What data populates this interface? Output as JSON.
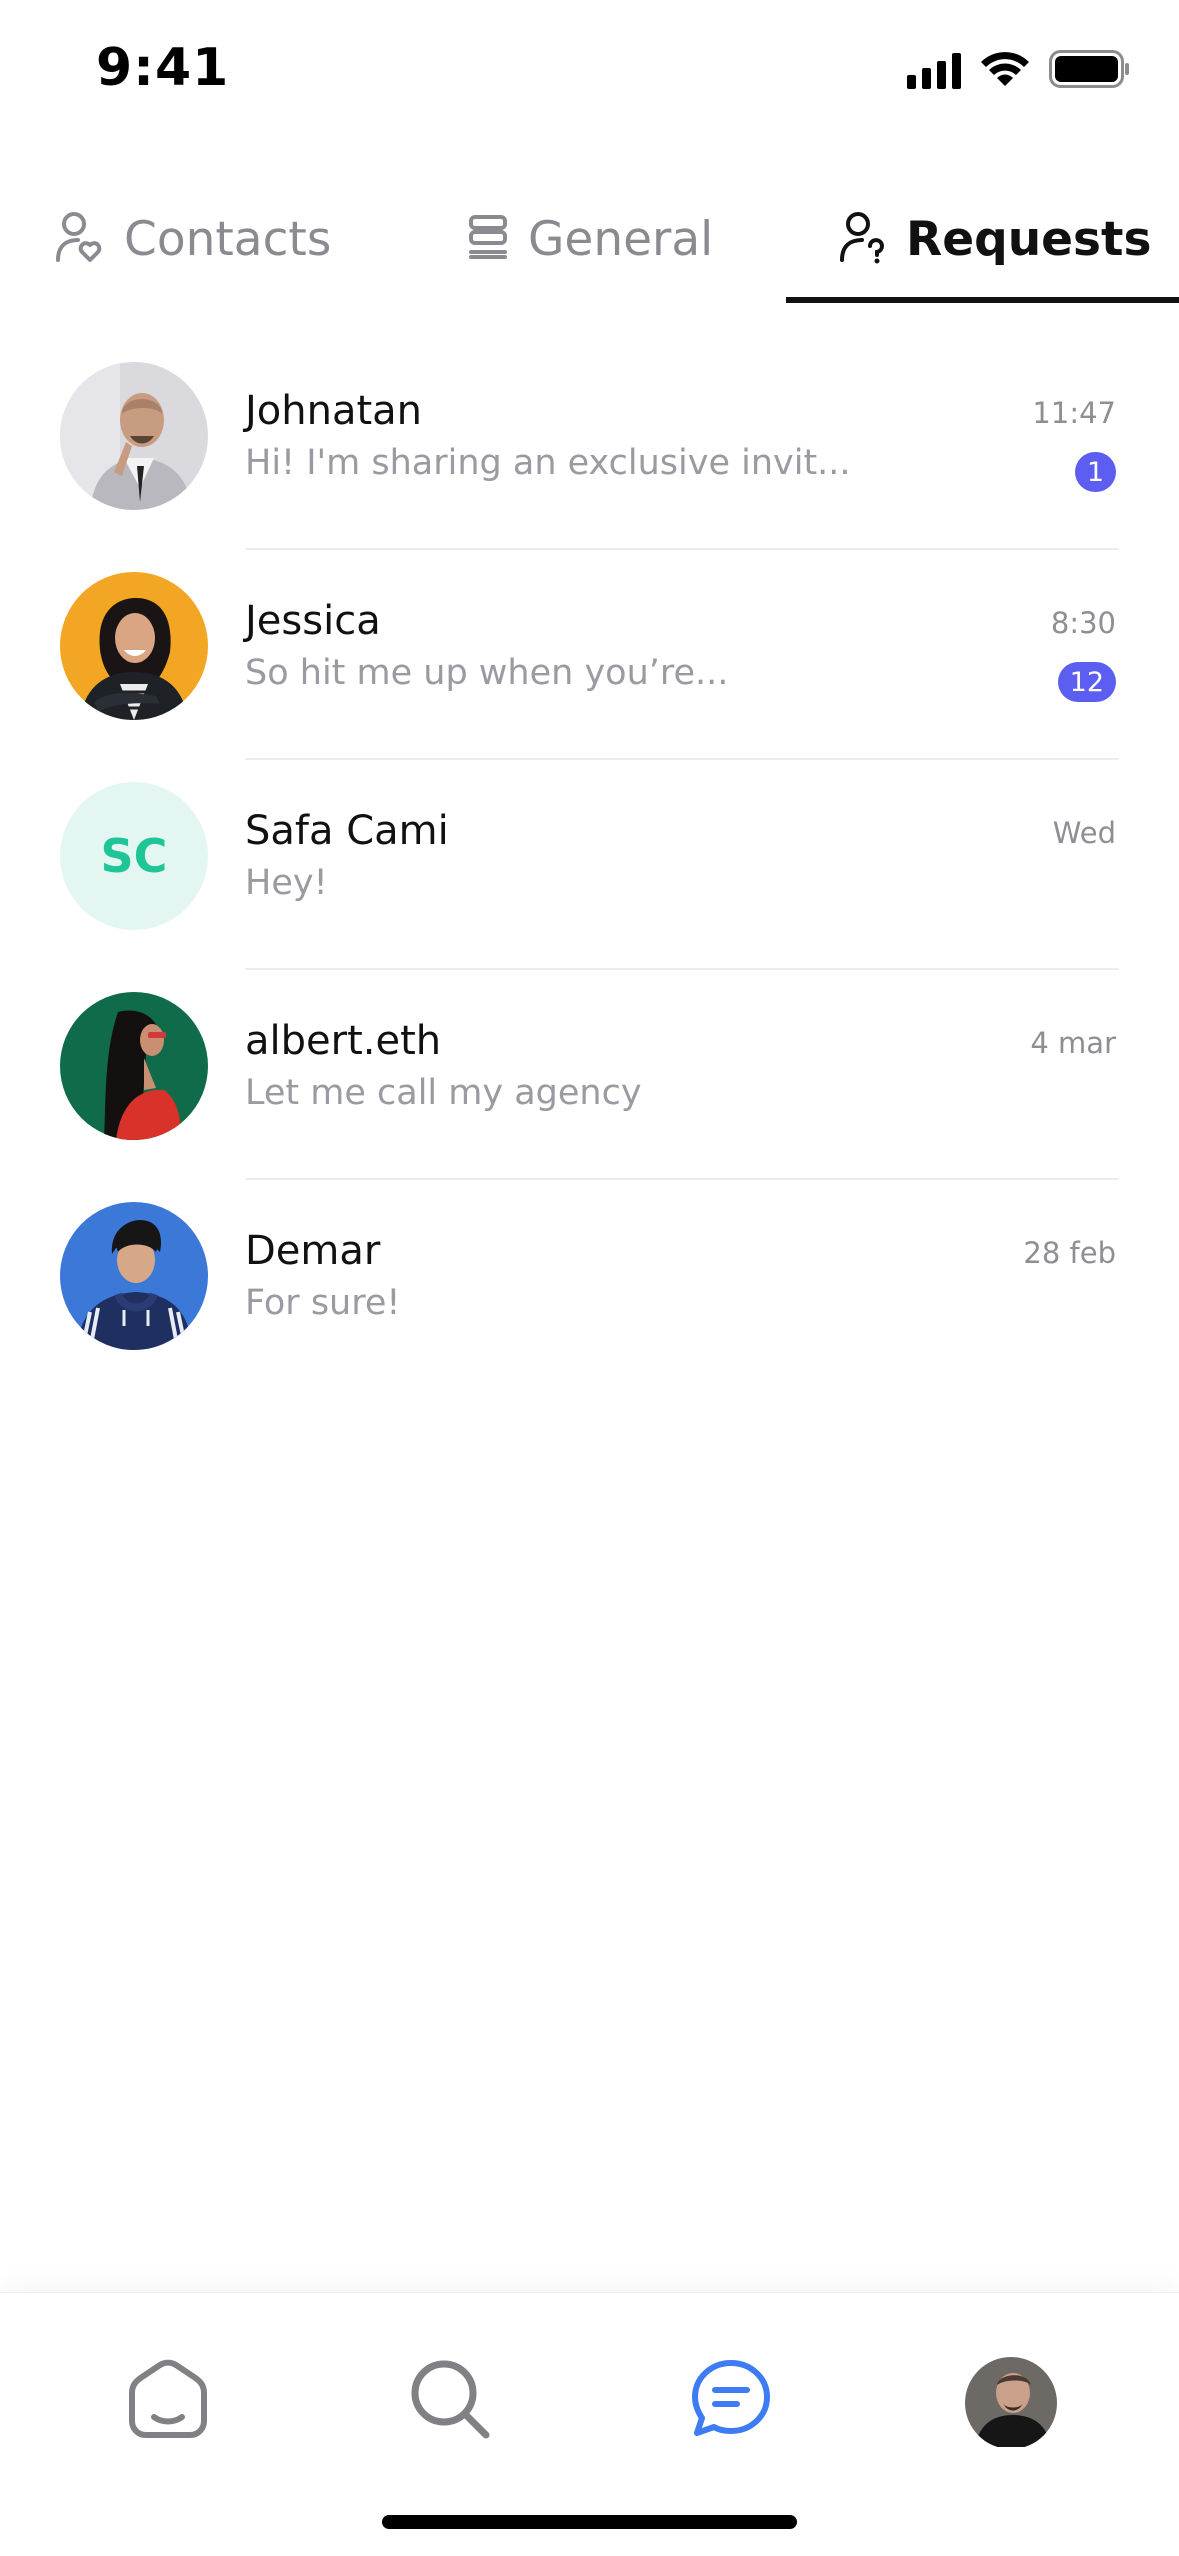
{
  "status_bar": {
    "time": "9:41"
  },
  "tabs": [
    {
      "label": "Contacts",
      "icon": "user-heart-icon",
      "active": false
    },
    {
      "label": "General",
      "icon": "stack-icon",
      "active": false
    },
    {
      "label": "Requests",
      "icon": "user-question-icon",
      "active": true
    }
  ],
  "conversations": [
    {
      "name": "Johnatan",
      "preview": "Hi! I'm sharing an exclusive invit...",
      "time": "11:47",
      "unread": "1"
    },
    {
      "name": "Jessica",
      "preview": "So hit me up when you’re...",
      "time": "8:30",
      "unread": "12"
    },
    {
      "name": "Safa Cami",
      "initials": "SC",
      "preview": "Hey!",
      "time": "Wed"
    },
    {
      "name": "albert.eth",
      "preview": "Let me call my agency",
      "time": "4 mar"
    },
    {
      "name": "Demar",
      "preview": "For sure!",
      "time": "28 feb"
    }
  ],
  "bottom_nav": [
    {
      "icon": "home-icon",
      "active": false
    },
    {
      "icon": "search-icon",
      "active": false
    },
    {
      "icon": "chat-icon",
      "active": true
    },
    {
      "icon": "profile-avatar",
      "active": false
    }
  ],
  "colors": {
    "accent": "#5b5ef0",
    "chat_active": "#3d7cf2",
    "initials_bg": "#e3f6f1",
    "initials_text": "#1fc596",
    "muted_text": "#9a9aa2"
  }
}
